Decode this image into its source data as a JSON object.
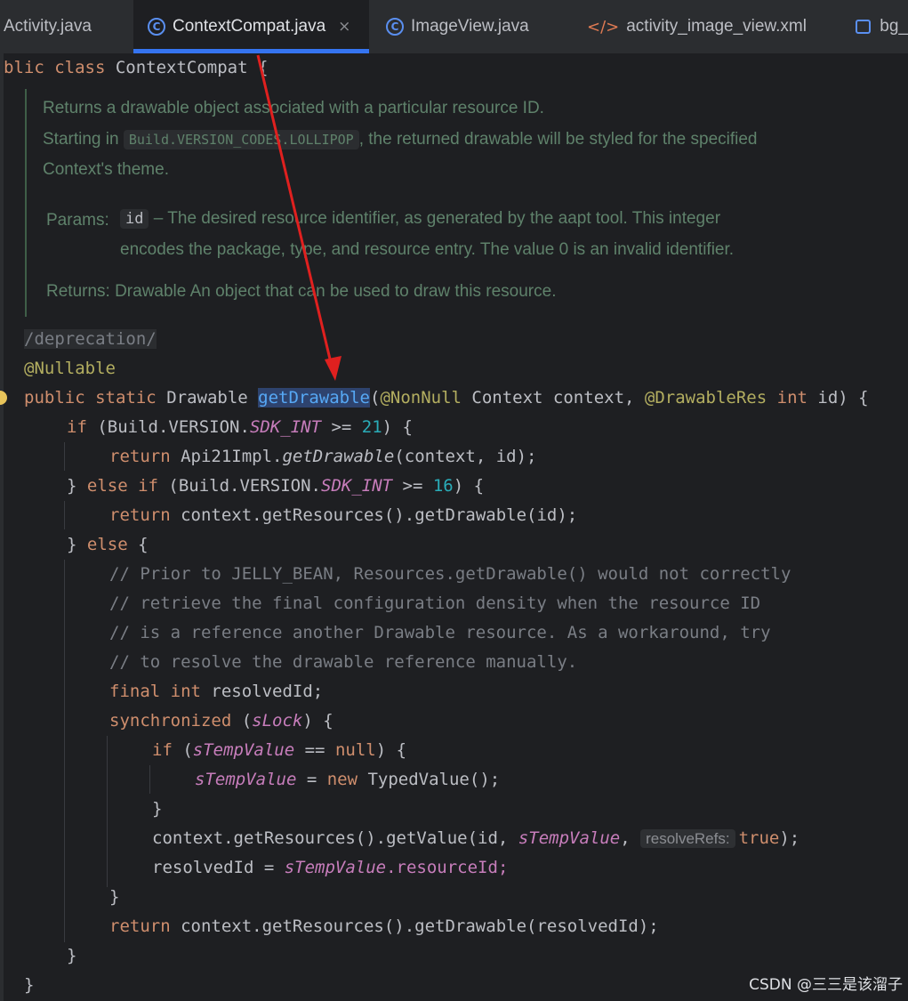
{
  "tabs": [
    {
      "label": "Activity.java",
      "icon": "none",
      "active": false
    },
    {
      "label": "ContextCompat.java",
      "icon": "class-icon",
      "active": true
    },
    {
      "label": "ImageView.java",
      "icon": "class-icon",
      "active": false
    },
    {
      "label": "activity_image_view.xml",
      "icon": "xml-icon",
      "active": false
    },
    {
      "label": "bg_",
      "icon": "image-icon",
      "active": false
    }
  ],
  "code": {
    "class_kw": "blic class",
    "class_name": "ContextCompat {",
    "deprecation": "/deprecation/",
    "nullable": "@Nullable",
    "sig_public": "public",
    "sig_static": "static",
    "sig_type": "Drawable",
    "sig_method": "getDrawable",
    "sig_paren": "(",
    "sig_nonnull": "@NonNull",
    "sig_ctx": "Context context,",
    "sig_dres": "@DrawableRes",
    "sig_int": "int",
    "sig_id": "id) {",
    "l1_if": "if",
    "l1_a": "(Build.VERSION.",
    "l1_sdk": "SDK_INT",
    "l1_ge": " >= ",
    "l1_num": "21",
    "l1_end": ") {",
    "l2_return": "return",
    "l2_a": "Api21Impl.",
    "l2_m": "getDrawable",
    "l2_end": "(context, id);",
    "l3_a": "} ",
    "l3_else": "else if",
    "l3_b": " (Build.VERSION.",
    "l3_sdk": "SDK_INT",
    "l3_ge": " >= ",
    "l3_num": "16",
    "l3_end": ") {",
    "l4_return": "return",
    "l4_rest": "context.getResources().getDrawable(id);",
    "l5_a": "} ",
    "l5_else": "else",
    "l5_end": " {",
    "c1": "// Prior to JELLY_BEAN, Resources.getDrawable() would not correctly",
    "c2": "// retrieve the final configuration density when the resource ID",
    "c3": "// is a reference another Drawable resource. As a workaround, try",
    "c4": "// to resolve the drawable reference manually.",
    "l6_final": "final int",
    "l6_rest": " resolvedId;",
    "l7_sync": "synchronized",
    "l7_a": " (",
    "l7_lock": "sLock",
    "l7_end": ") {",
    "l8_if": "if",
    "l8_a": " (",
    "l8_tv": "sTempValue",
    "l8_eq": " == ",
    "l8_null": "null",
    "l8_end": ") {",
    "l9_tv": "sTempValue",
    "l9_eq": " = ",
    "l9_new": "new",
    "l9_end": " TypedValue();",
    "l10": "}",
    "l11_a": "context.getResources().getValue(id, ",
    "l11_tv": "sTempValue",
    "l11_comma": ", ",
    "l11_hint": "resolveRefs:",
    "l11_true": "true",
    "l11_end": ");",
    "l12_a": "resolvedId = ",
    "l12_tv": "sTempValue",
    "l12_end": ".resourceId;",
    "l13": "}",
    "l14_return": "return",
    "l14_rest": " context.getResources().getDrawable(resolvedId);",
    "l15": "}",
    "l16": "}"
  },
  "doc": {
    "line1": "Returns a drawable object associated with a particular resource ID.",
    "line2_a": "Starting in",
    "line2_badge": "Build.VERSION_CODES.LOLLIPOP",
    "line2_b": ", the returned drawable will be styled for the specified",
    "line3": "Context's theme.",
    "params_label": "Params:",
    "params_badge": "id",
    "params_text1": "– The desired resource identifier, as generated by the aapt tool. This integer",
    "params_text2": "encodes the package, type, and resource entry. The value 0 is an invalid identifier.",
    "returns": "Returns: Drawable An object that can be used to draw this resource."
  },
  "watermark": "CSDN @三三是该溜子",
  "colors": {
    "background": "#1e1f22",
    "keyword": "#cf8e6d",
    "annotation": "#b3ae60",
    "method": "#56a8f5",
    "static_field": "#c77dbb",
    "number": "#2aacb8",
    "comment": "#7a7e85",
    "doc": "#5f826b",
    "arrow": "#e0201f",
    "tab_underline": "#3574f0"
  }
}
